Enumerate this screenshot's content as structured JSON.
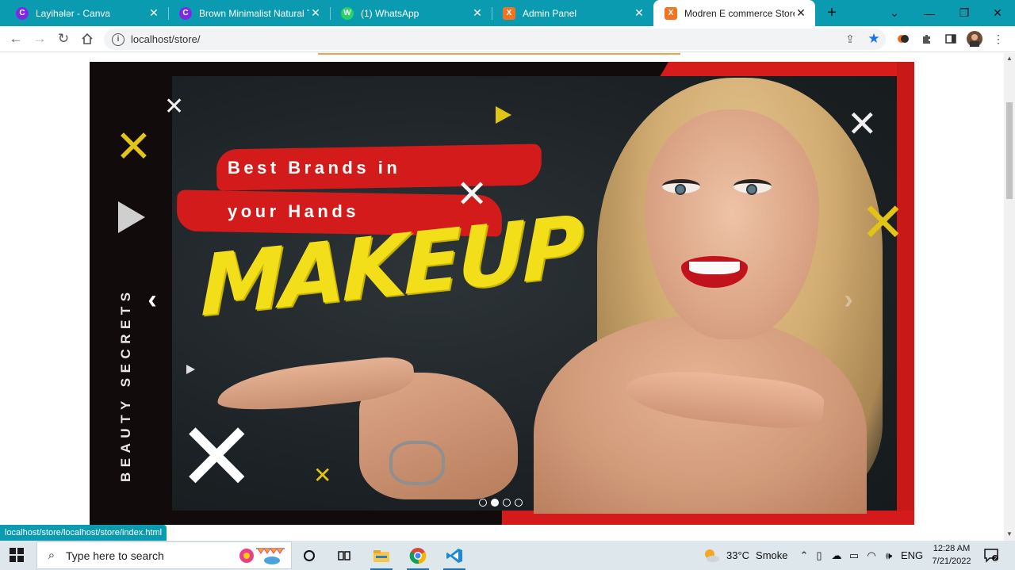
{
  "browser": {
    "tabs": [
      {
        "title": "Layihələr - Canva",
        "favicon_color": "#7d2ae8",
        "favicon_glyph": "C"
      },
      {
        "title": "Brown Minimalist Natural Tre",
        "favicon_color": "#7d2ae8",
        "favicon_glyph": "C"
      },
      {
        "title": "(1) WhatsApp",
        "favicon_color": "#25d366",
        "favicon_glyph": "W"
      },
      {
        "title": "Admin Panel",
        "favicon_color": "#f37321",
        "favicon_glyph": "X"
      },
      {
        "title": "Modren E commerce Store",
        "favicon_color": "#f37321",
        "favicon_glyph": "X",
        "active": true
      }
    ],
    "new_tab": "+",
    "url": "localhost/store/",
    "status_url": "localhost/store/localhost/store/index.html"
  },
  "banner": {
    "side_text": "BEAUTY SECRETS",
    "tagline_line1": "Best Brands in",
    "tagline_line2": "your Hands",
    "headline": "MAKEUP",
    "prev_arrow": "‹",
    "next_arrow": "›",
    "slide_count": 4,
    "active_slide": 2
  },
  "taskbar": {
    "search_placeholder": "Type here to search",
    "weather_temp": "33°C",
    "weather_desc": "Smoke",
    "language": "ENG",
    "time": "12:28 AM",
    "date": "7/21/2022"
  },
  "colors": {
    "tabstrip": "#0a9bb0",
    "banner_red": "#d41b1b",
    "headline_yellow": "#f2de19",
    "orange_accent": "#f5a04a"
  }
}
